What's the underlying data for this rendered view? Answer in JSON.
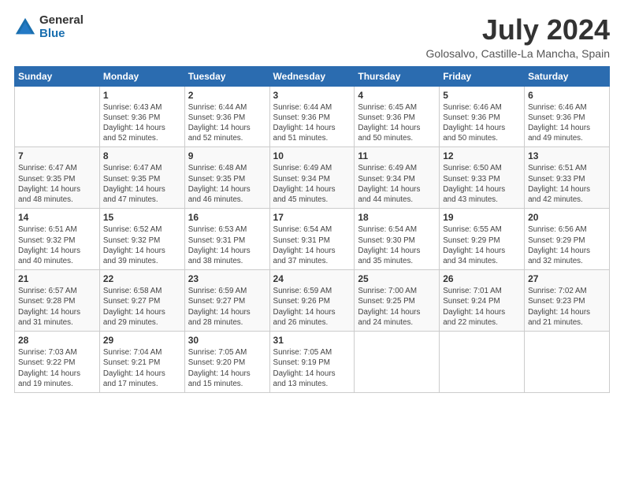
{
  "logo": {
    "general": "General",
    "blue": "Blue"
  },
  "title": "July 2024",
  "location": "Golosalvo, Castille-La Mancha, Spain",
  "weekdays": [
    "Sunday",
    "Monday",
    "Tuesday",
    "Wednesday",
    "Thursday",
    "Friday",
    "Saturday"
  ],
  "weeks": [
    [
      {
        "day": "",
        "info": ""
      },
      {
        "day": "1",
        "info": "Sunrise: 6:43 AM\nSunset: 9:36 PM\nDaylight: 14 hours\nand 52 minutes."
      },
      {
        "day": "2",
        "info": "Sunrise: 6:44 AM\nSunset: 9:36 PM\nDaylight: 14 hours\nand 52 minutes."
      },
      {
        "day": "3",
        "info": "Sunrise: 6:44 AM\nSunset: 9:36 PM\nDaylight: 14 hours\nand 51 minutes."
      },
      {
        "day": "4",
        "info": "Sunrise: 6:45 AM\nSunset: 9:36 PM\nDaylight: 14 hours\nand 50 minutes."
      },
      {
        "day": "5",
        "info": "Sunrise: 6:46 AM\nSunset: 9:36 PM\nDaylight: 14 hours\nand 50 minutes."
      },
      {
        "day": "6",
        "info": "Sunrise: 6:46 AM\nSunset: 9:36 PM\nDaylight: 14 hours\nand 49 minutes."
      }
    ],
    [
      {
        "day": "7",
        "info": "Sunrise: 6:47 AM\nSunset: 9:35 PM\nDaylight: 14 hours\nand 48 minutes."
      },
      {
        "day": "8",
        "info": "Sunrise: 6:47 AM\nSunset: 9:35 PM\nDaylight: 14 hours\nand 47 minutes."
      },
      {
        "day": "9",
        "info": "Sunrise: 6:48 AM\nSunset: 9:35 PM\nDaylight: 14 hours\nand 46 minutes."
      },
      {
        "day": "10",
        "info": "Sunrise: 6:49 AM\nSunset: 9:34 PM\nDaylight: 14 hours\nand 45 minutes."
      },
      {
        "day": "11",
        "info": "Sunrise: 6:49 AM\nSunset: 9:34 PM\nDaylight: 14 hours\nand 44 minutes."
      },
      {
        "day": "12",
        "info": "Sunrise: 6:50 AM\nSunset: 9:33 PM\nDaylight: 14 hours\nand 43 minutes."
      },
      {
        "day": "13",
        "info": "Sunrise: 6:51 AM\nSunset: 9:33 PM\nDaylight: 14 hours\nand 42 minutes."
      }
    ],
    [
      {
        "day": "14",
        "info": "Sunrise: 6:51 AM\nSunset: 9:32 PM\nDaylight: 14 hours\nand 40 minutes."
      },
      {
        "day": "15",
        "info": "Sunrise: 6:52 AM\nSunset: 9:32 PM\nDaylight: 14 hours\nand 39 minutes."
      },
      {
        "day": "16",
        "info": "Sunrise: 6:53 AM\nSunset: 9:31 PM\nDaylight: 14 hours\nand 38 minutes."
      },
      {
        "day": "17",
        "info": "Sunrise: 6:54 AM\nSunset: 9:31 PM\nDaylight: 14 hours\nand 37 minutes."
      },
      {
        "day": "18",
        "info": "Sunrise: 6:54 AM\nSunset: 9:30 PM\nDaylight: 14 hours\nand 35 minutes."
      },
      {
        "day": "19",
        "info": "Sunrise: 6:55 AM\nSunset: 9:29 PM\nDaylight: 14 hours\nand 34 minutes."
      },
      {
        "day": "20",
        "info": "Sunrise: 6:56 AM\nSunset: 9:29 PM\nDaylight: 14 hours\nand 32 minutes."
      }
    ],
    [
      {
        "day": "21",
        "info": "Sunrise: 6:57 AM\nSunset: 9:28 PM\nDaylight: 14 hours\nand 31 minutes."
      },
      {
        "day": "22",
        "info": "Sunrise: 6:58 AM\nSunset: 9:27 PM\nDaylight: 14 hours\nand 29 minutes."
      },
      {
        "day": "23",
        "info": "Sunrise: 6:59 AM\nSunset: 9:27 PM\nDaylight: 14 hours\nand 28 minutes."
      },
      {
        "day": "24",
        "info": "Sunrise: 6:59 AM\nSunset: 9:26 PM\nDaylight: 14 hours\nand 26 minutes."
      },
      {
        "day": "25",
        "info": "Sunrise: 7:00 AM\nSunset: 9:25 PM\nDaylight: 14 hours\nand 24 minutes."
      },
      {
        "day": "26",
        "info": "Sunrise: 7:01 AM\nSunset: 9:24 PM\nDaylight: 14 hours\nand 22 minutes."
      },
      {
        "day": "27",
        "info": "Sunrise: 7:02 AM\nSunset: 9:23 PM\nDaylight: 14 hours\nand 21 minutes."
      }
    ],
    [
      {
        "day": "28",
        "info": "Sunrise: 7:03 AM\nSunset: 9:22 PM\nDaylight: 14 hours\nand 19 minutes."
      },
      {
        "day": "29",
        "info": "Sunrise: 7:04 AM\nSunset: 9:21 PM\nDaylight: 14 hours\nand 17 minutes."
      },
      {
        "day": "30",
        "info": "Sunrise: 7:05 AM\nSunset: 9:20 PM\nDaylight: 14 hours\nand 15 minutes."
      },
      {
        "day": "31",
        "info": "Sunrise: 7:05 AM\nSunset: 9:19 PM\nDaylight: 14 hours\nand 13 minutes."
      },
      {
        "day": "",
        "info": ""
      },
      {
        "day": "",
        "info": ""
      },
      {
        "day": "",
        "info": ""
      }
    ]
  ]
}
